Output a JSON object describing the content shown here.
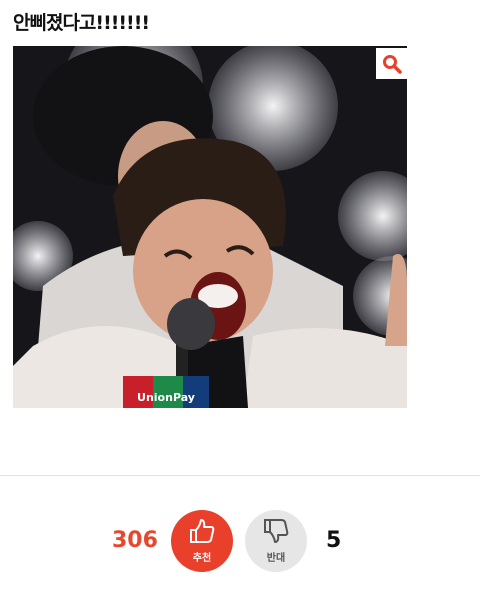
{
  "post": {
    "title": "안삐졌다고!!!!!!!"
  },
  "image": {
    "icons": {
      "zoom": "magnifier-icon"
    },
    "caption_text": "UnionPay"
  },
  "vote": {
    "up_count": "306",
    "up_label": "추천",
    "down_count": "5",
    "down_label": "반대",
    "colors": {
      "up": "#e8402a",
      "up_count": "#e8462d",
      "down_bg": "#e6e6e6"
    },
    "icons": {
      "up": "thumbs-up-icon",
      "down": "thumbs-down-icon"
    }
  }
}
